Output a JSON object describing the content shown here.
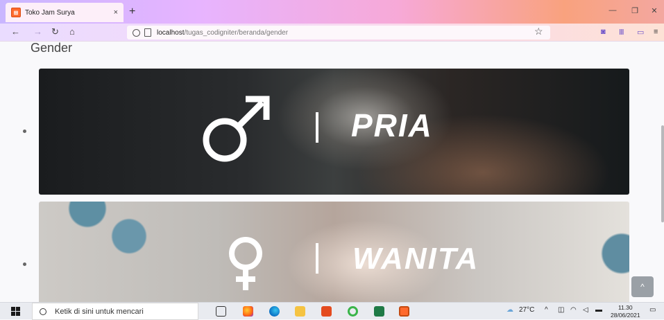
{
  "browser": {
    "tab_title": "Toko Jam Surya",
    "tab_close": "×",
    "new_tab": "+",
    "url_host": "localhost",
    "url_path": "/tugas_codigniter/beranda/gender",
    "window_controls": [
      "—",
      "❐",
      "✕"
    ]
  },
  "page": {
    "heading": "Gender",
    "cards": [
      {
        "label": "PRIA",
        "symbol": "male-symbol"
      },
      {
        "label": "WANITA",
        "symbol": "female-symbol"
      }
    ],
    "scroll_top_label": "^"
  },
  "taskbar": {
    "search_placeholder": "Ketik di sini untuk mencari",
    "weather": "27°C",
    "time": "11.30",
    "date": "28/06/2021"
  },
  "colors": {
    "tab_gradient_start": "#c9b6ff",
    "tab_gradient_end": "#f9a27e",
    "accent": "#ff6a2e",
    "scroll_button": "#9aa0a6"
  }
}
